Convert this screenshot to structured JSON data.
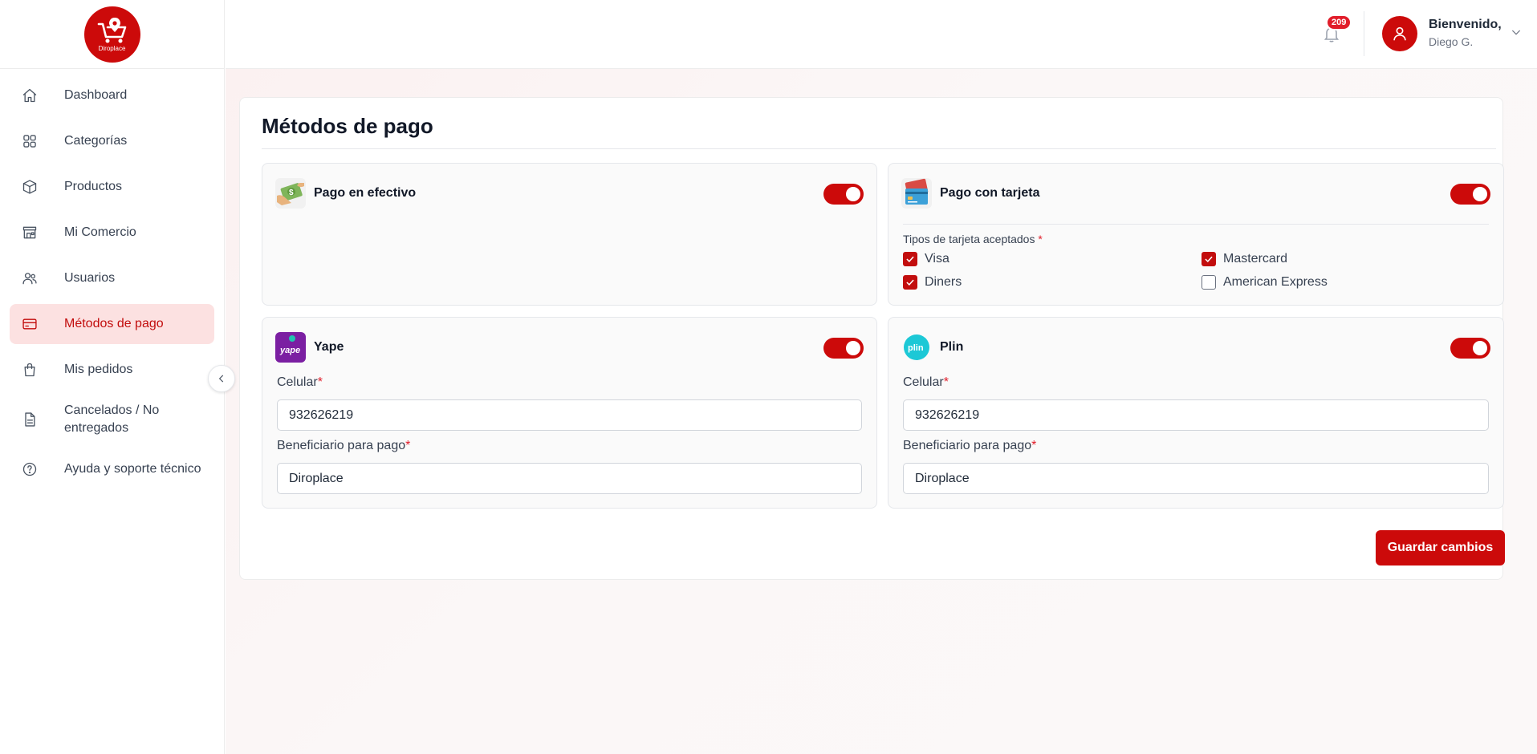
{
  "brand": {
    "name": "Diroplace",
    "color": "#cc0a0a"
  },
  "sidebar": {
    "items": [
      {
        "label": "Dashboard",
        "icon": "home-icon",
        "active": false
      },
      {
        "label": "Categorías",
        "icon": "grid-icon",
        "active": false
      },
      {
        "label": "Productos",
        "icon": "box-icon",
        "active": false
      },
      {
        "label": "Mi Comercio",
        "icon": "store-icon",
        "active": false
      },
      {
        "label": "Usuarios",
        "icon": "users-icon",
        "active": false
      },
      {
        "label": "Métodos de pago",
        "icon": "credit-card-icon",
        "active": true
      },
      {
        "label": "Mis pedidos",
        "icon": "shopping-bag-icon",
        "active": false
      },
      {
        "label": "Cancelados / No entregados",
        "icon": "document-icon",
        "active": false
      },
      {
        "label": "Ayuda y soporte técnico",
        "icon": "help-circle-icon",
        "active": false
      }
    ]
  },
  "header": {
    "notifications_count": "209",
    "welcome": "Bienvenido,",
    "user_name": "Diego G."
  },
  "page": {
    "title": "Métodos de pago",
    "cash": {
      "name": "Pago en efectivo",
      "enabled": true
    },
    "card": {
      "name": "Pago con tarjeta",
      "enabled": true,
      "types_label": "Tipos de tarjeta aceptados",
      "types": [
        {
          "label": "Visa",
          "checked": true
        },
        {
          "label": "Mastercard",
          "checked": true
        },
        {
          "label": "Diners",
          "checked": true
        },
        {
          "label": "American Express",
          "checked": false
        }
      ]
    },
    "yape": {
      "name": "Yape",
      "enabled": true,
      "phone_label": "Celular",
      "phone_value": "932626219",
      "beneficiary_label": "Beneficiario para pago",
      "beneficiary_value": "Diroplace"
    },
    "plin": {
      "name": "Plin",
      "enabled": true,
      "phone_label": "Celular",
      "phone_value": "932626219",
      "beneficiary_label": "Beneficiario para pago",
      "beneficiary_value": "Diroplace"
    },
    "required_mark": "*",
    "save_label": "Guardar cambios"
  }
}
